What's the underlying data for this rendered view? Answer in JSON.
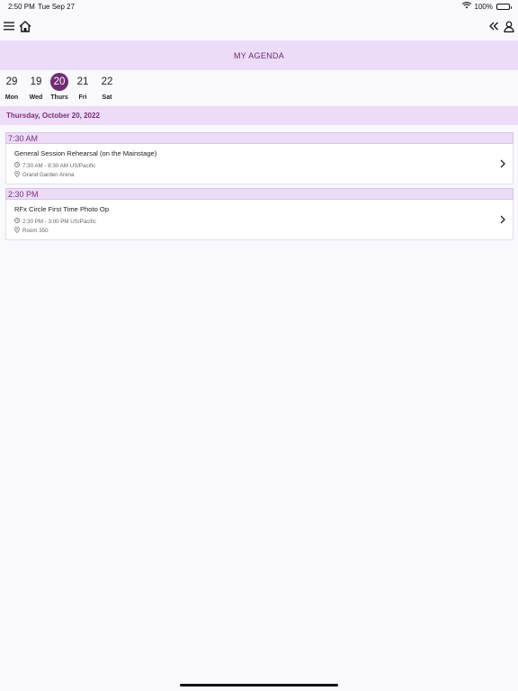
{
  "status_bar": {
    "time": "2:50 PM",
    "date": "Tue Sep 27",
    "battery": "100%"
  },
  "header": {
    "title": "MY AGENDA"
  },
  "days": [
    {
      "num": "29",
      "label": "Mon"
    },
    {
      "num": "19",
      "label": "Wed"
    },
    {
      "num": "20",
      "label": "Thurs"
    },
    {
      "num": "21",
      "label": "Fri"
    },
    {
      "num": "22",
      "label": "Sat"
    }
  ],
  "selected_day_index": 2,
  "date_heading": "Thursday, October 20, 2022",
  "sessions": [
    {
      "slot": "7:30 AM",
      "title": "General Session Rehearsal (on the Mainstage)",
      "time": "7:30 AM - 8:30 AM US/Pacific",
      "location": "Grand Garden Arena"
    },
    {
      "slot": "2:30 PM",
      "title": "RFx Circle First Time Photo Op",
      "time": "2:30 PM - 3:00 PM US/Pacific",
      "location": "Room 350"
    }
  ],
  "colors": {
    "accent": "#6f2c73",
    "band": "#ecdcf8",
    "slot_text": "#7a2f7a"
  }
}
